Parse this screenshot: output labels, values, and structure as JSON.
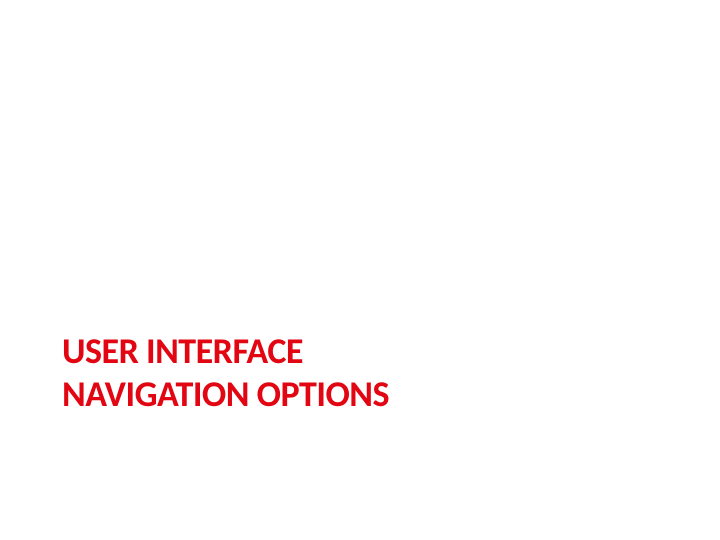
{
  "slide": {
    "title_line1": "USER INTERFACE",
    "title_line2": "NAVIGATION OPTIONS"
  }
}
